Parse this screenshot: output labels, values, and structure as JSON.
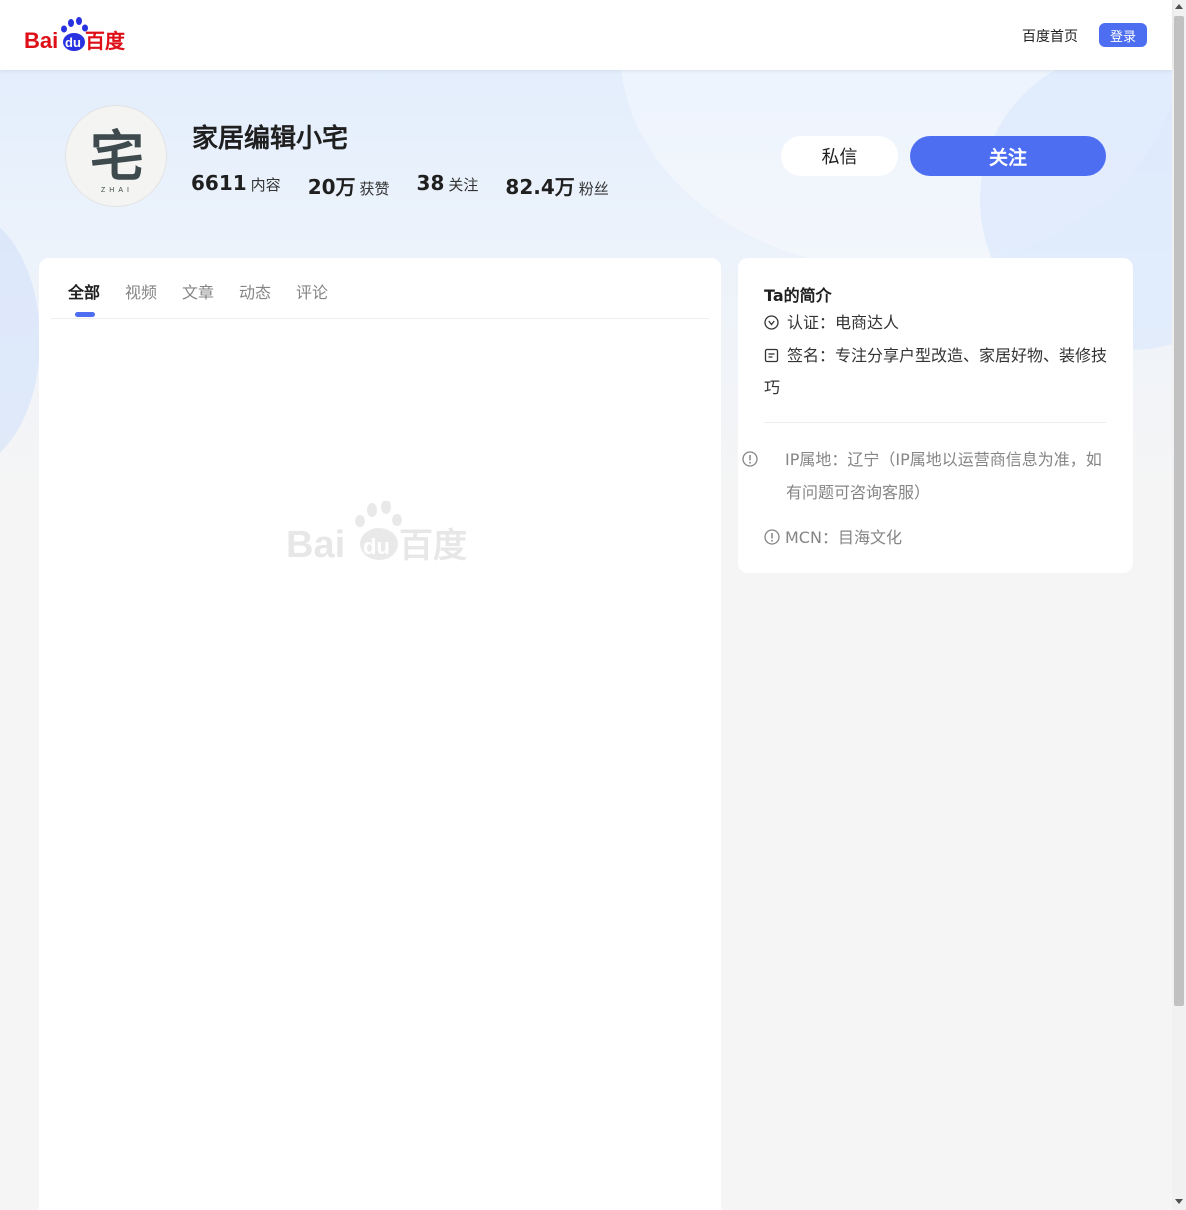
{
  "header": {
    "logo_text_latin": "Bai",
    "logo_text_du": "du",
    "logo_text_cn": "百度",
    "home_link": "百度首页",
    "login_label": "登录"
  },
  "profile": {
    "name": "家居编辑小宅",
    "avatar_glyph": "宅",
    "avatar_caption": "ZHAI",
    "stats": [
      {
        "value": "6611",
        "label": "内容"
      },
      {
        "value": "20万",
        "label": "获赞"
      },
      {
        "value": "38",
        "label": "关注"
      },
      {
        "value": "82.4万",
        "label": "粉丝"
      }
    ],
    "message_label": "私信",
    "follow_label": "关注"
  },
  "tabs": [
    {
      "label": "全部",
      "active": true
    },
    {
      "label": "视频",
      "active": false
    },
    {
      "label": "文章",
      "active": false
    },
    {
      "label": "动态",
      "active": false
    },
    {
      "label": "评论",
      "active": false
    }
  ],
  "intro": {
    "title": "Ta的简介",
    "certification": "认证：电商达人",
    "signature": "签名：专注分享户型改造、家居好物、装修技巧",
    "ip_location": "IP属地：辽宁（IP属地以运营商信息为准，如有问题可咨询客服）",
    "mcn": "MCN：目海文化"
  },
  "colors": {
    "accent": "#4e6ef2",
    "baidu_red": "#de0f17",
    "baidu_blue": "#2932e1"
  },
  "icons": {
    "cert": "verified-check-icon",
    "signature": "document-icon",
    "ip": "info-icon",
    "mcn": "info-icon"
  }
}
